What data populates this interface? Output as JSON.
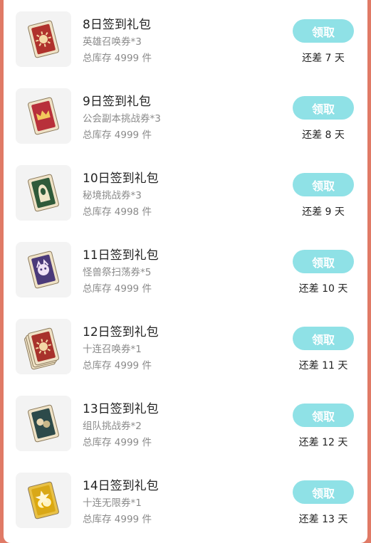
{
  "rows": [
    {
      "title": "8日签到礼包",
      "item": "英雄召唤券*3",
      "stock": "总库存 4999 件",
      "button": "领取",
      "remaining": "还差 7 天",
      "art": "sun",
      "color": "#b0322c"
    },
    {
      "title": "9日签到礼包",
      "item": "公会副本挑战券*3",
      "stock": "总库存 4999 件",
      "button": "领取",
      "remaining": "还差 8 天",
      "art": "crown",
      "color": "#b8303a"
    },
    {
      "title": "10日签到礼包",
      "item": "秘境挑战券*3",
      "stock": "总库存 4998 件",
      "button": "领取",
      "remaining": "还差 9 天",
      "art": "hood",
      "color": "#2f5a3a"
    },
    {
      "title": "11日签到礼包",
      "item": "怪兽祭扫荡券*5",
      "stock": "总库存 4999 件",
      "button": "领取",
      "remaining": "还差 10 天",
      "art": "beast",
      "color": "#4b3a7a"
    },
    {
      "title": "12日签到礼包",
      "item": "十连召唤券*1",
      "stock": "总库存 4999 件",
      "button": "领取",
      "remaining": "还差 11 天",
      "art": "stack",
      "color": "#a8322c"
    },
    {
      "title": "13日签到礼包",
      "item": "组队挑战券*2",
      "stock": "总库存 4999 件",
      "button": "领取",
      "remaining": "还差 12 天",
      "art": "team",
      "color": "#2d4a4a"
    },
    {
      "title": "14日签到礼包",
      "item": "十连无限券*1",
      "stock": "总库存 4999 件",
      "button": "领取",
      "remaining": "还差 13 天",
      "art": "gold",
      "color": "#d9a817"
    }
  ]
}
